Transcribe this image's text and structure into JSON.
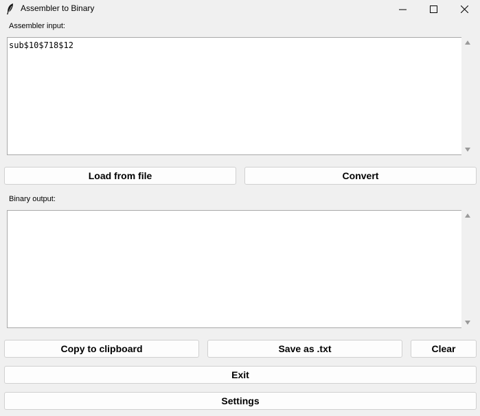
{
  "window": {
    "title": "Assembler to Binary",
    "icon": "feather-icon"
  },
  "input": {
    "label": "Assembler input:",
    "value": "sub$10$718$12"
  },
  "output": {
    "label": "Binary output:",
    "value": ""
  },
  "buttons": {
    "load": "Load from file",
    "convert": "Convert",
    "copy": "Copy to clipboard",
    "save": "Save as .txt",
    "clear": "Clear",
    "exit": "Exit",
    "settings": "Settings"
  }
}
